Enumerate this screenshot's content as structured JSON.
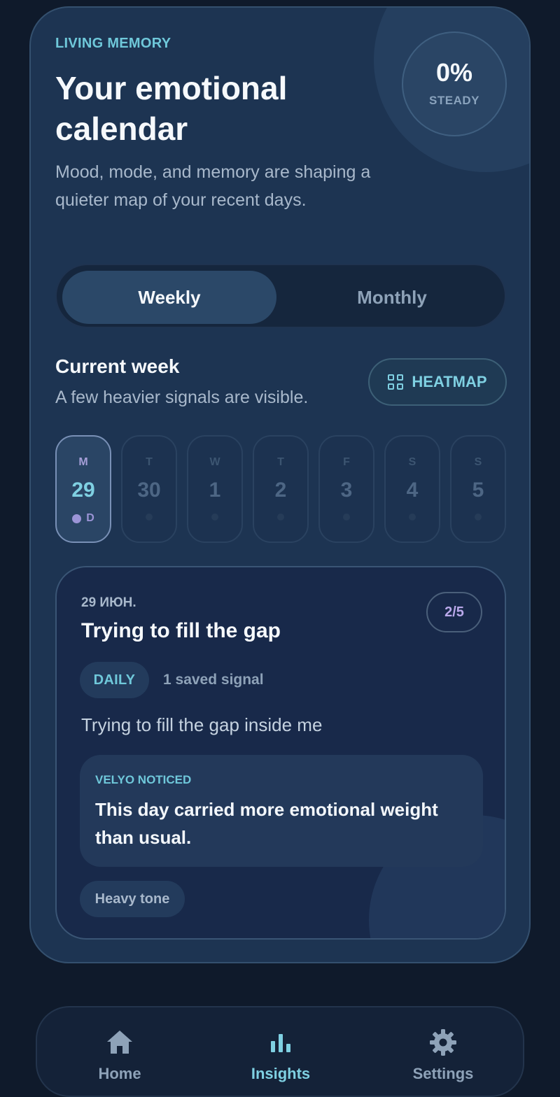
{
  "header": {
    "eyebrow": "LIVING MEMORY",
    "title": "Your emotional calendar",
    "subtitle": "Mood, mode, and memory are shaping a quieter map of your recent days.",
    "badge": {
      "value": "0%",
      "label": "STEADY"
    }
  },
  "toggle": {
    "weekly": "Weekly",
    "monthly": "Monthly",
    "selected": "Weekly"
  },
  "week": {
    "title": "Current week",
    "subtitle": "A few heavier signals are visible.",
    "heatmap_label": "HEATMAP",
    "days": [
      {
        "letter": "M",
        "num": "29",
        "mark": "D",
        "selected": true
      },
      {
        "letter": "T",
        "num": "30"
      },
      {
        "letter": "W",
        "num": "1"
      },
      {
        "letter": "T",
        "num": "2"
      },
      {
        "letter": "F",
        "num": "3"
      },
      {
        "letter": "S",
        "num": "4"
      },
      {
        "letter": "S",
        "num": "5"
      }
    ]
  },
  "entry": {
    "date": "29 ИЮН.",
    "title": "Trying to fill the gap",
    "count": "2/5",
    "mode_chip": "DAILY",
    "saved_signal": "1 saved signal",
    "text": "Trying to fill the gap inside me",
    "noticed_label": "VELYO NOTICED",
    "noticed_text": "This day carried more emotional weight than usual.",
    "tone_chip": "Heavy tone"
  },
  "nav": {
    "items": [
      {
        "label": "Home",
        "icon": "home-icon"
      },
      {
        "label": "Insights",
        "icon": "bar-chart-icon",
        "active": true
      },
      {
        "label": "Settings",
        "icon": "gear-icon"
      }
    ]
  },
  "colors": {
    "accent_cyan": "#7fd0e2",
    "accent_violet": "#9b94d6",
    "card_bg": "#1d3452",
    "page_bg": "#0f1a2b"
  }
}
